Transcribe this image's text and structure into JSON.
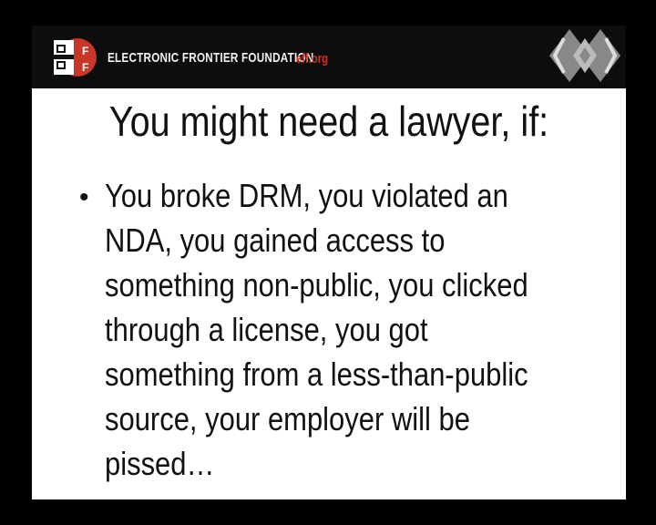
{
  "header": {
    "organization": "ELECTRONIC FRONTIER FOUNDATION",
    "url": "eff.org",
    "logo_text": "EFF",
    "logo_icon": "eff-logo-icon",
    "conference_icon": "diamond-logo-icon"
  },
  "slide": {
    "title": "You might need a lawyer, if:",
    "bullets": [
      "You broke DRM, you violated an NDA, you gained access to something non-public, you clicked through a license, you got something from a less-than-public source, your employer will be pissed…"
    ]
  },
  "colors": {
    "accent": "#c9362a",
    "header_bg": "#0d0d0d"
  }
}
